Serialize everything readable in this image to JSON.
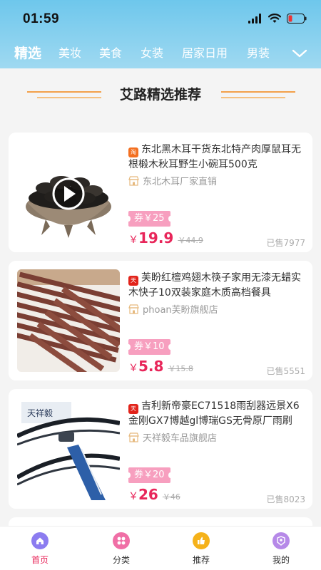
{
  "status": {
    "time": "01:59"
  },
  "tabs": [
    {
      "label": "精选",
      "active": true
    },
    {
      "label": "美妆"
    },
    {
      "label": "美食"
    },
    {
      "label": "女装"
    },
    {
      "label": "居家日用"
    },
    {
      "label": "男装"
    }
  ],
  "section": {
    "title": "艾路精选推荐"
  },
  "products": [
    {
      "title": "东北黑木耳干货东北特产肉厚鼠耳无根椴木秋耳野生小碗耳500克",
      "shop": "东北木耳厂家直销",
      "coupon": "券￥25",
      "currency": "￥",
      "price": "19.9",
      "original_price": "￥44.9",
      "sold": "已售7977",
      "platform": "taobao-icon",
      "platform_color": "#f37021"
    },
    {
      "title": "芙盼红檀鸡翅木筷子家用无漆无蜡实木快子10双装家庭木质高档餐具",
      "shop": "phoan芙盼旗舰店",
      "coupon": "券￥10",
      "currency": "￥",
      "price": "5.8",
      "original_price": "￥15.8",
      "sold": "已售5551",
      "platform": "tmall-icon",
      "platform_color": "#e2231a"
    },
    {
      "title": "吉利新帝豪EC71518雨刮器远景X6金刚GX7博越gl博瑞GS无骨原厂雨刷",
      "shop": "天祥毅车品旗舰店",
      "coupon": "券￥20",
      "currency": "￥",
      "price": "26",
      "original_price": "￥46",
      "sold": "已售8023",
      "platform": "tmall-icon",
      "platform_color": "#e2231a"
    }
  ],
  "bottom_nav": [
    {
      "label": "首页",
      "icon": "home-icon",
      "color": "#8c7cf0",
      "active": true
    },
    {
      "label": "分类",
      "icon": "category-icon",
      "color": "#f06fa6"
    },
    {
      "label": "推荐",
      "icon": "thumb-up-icon",
      "color": "#f5b21a"
    },
    {
      "label": "我的",
      "icon": "profile-icon",
      "color": "#b689e8"
    }
  ]
}
